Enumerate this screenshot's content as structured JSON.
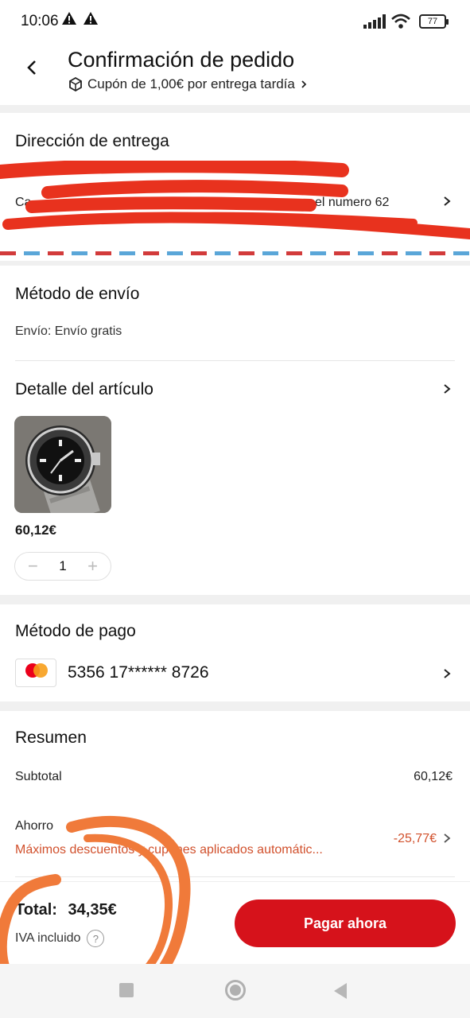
{
  "status_bar": {
    "time": "10:06",
    "battery": "77"
  },
  "header": {
    "title": "Confirmación de pedido",
    "coupon_text": "Cupón de 1,00€ por entrega tardía"
  },
  "delivery": {
    "title": "Dirección de entrega",
    "address_fragment_left": "Ca",
    "address_fragment_right": "el numero 62"
  },
  "shipping": {
    "title": "Método de envío",
    "value": "Envío: Envío gratis"
  },
  "item": {
    "title": "Detalle del artículo",
    "price": "60,12€",
    "quantity": "1"
  },
  "payment": {
    "title": "Método de pago",
    "card_number": "5356 17****** 8726",
    "card_brand_label": "mastercard"
  },
  "summary": {
    "title": "Resumen",
    "subtotal_label": "Subtotal",
    "subtotal_value": "60,12€",
    "savings_label": "Ahorro",
    "savings_note": "Máximos descuentos y cupones aplicados automátic...",
    "savings_value": "-25,77€"
  },
  "footer": {
    "total_label": "Total:",
    "total_value": "34,35€",
    "tax_note": "IVA incluido",
    "pay_button": "Pagar ahora"
  },
  "colors": {
    "accent": "#d6121b",
    "savings": "#d1502c"
  }
}
